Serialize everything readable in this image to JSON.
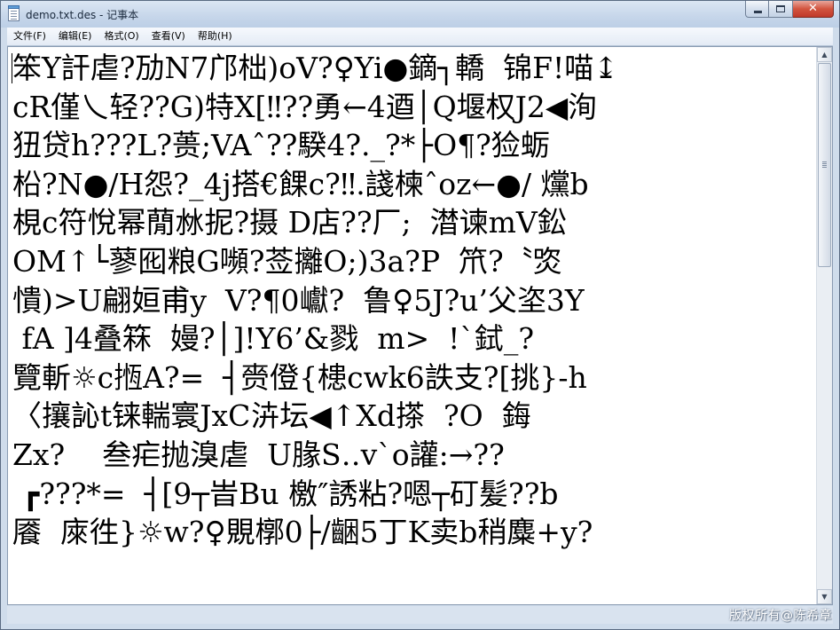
{
  "window": {
    "title": "demo.txt.des - 记事本",
    "close_glyph": "✕"
  },
  "menu": {
    "items": [
      "文件(F)",
      "编辑(E)",
      "格式(O)",
      "查看(V)",
      "帮助(H)"
    ]
  },
  "document": {
    "lines": [
      "笨Y訐虐?劢N7邝柮)oV?♀Yi●鏑┐轎  锦F!喵↨",
      "cR僅乀轻??G)特X[‼??勇←4逎│Q堰权J2◀洵",
      "狃贷h???L?蒉;VAˆ??騤4?._?*├O¶?猃蛎",
      "柗?N●/H怨?_4j搭€餜c?‼.諓楝ˆoz←●/ 爣b",
      "梘c符悅幂蕑沝抳?摄 D店??厂;  澘谏mV鈆",
      "OM↑└蓼囮粮G嚬?莶攡O;)3a?P  笊?〝焁",
      "憒)>U翩姮甫y  V?¶0巘?  鲁♀5J?u’父垐3Y",
      " fA ]4叠箖  嫚?│]!Y6’&戮  m>  !`鉽_?",
      "覽斬☼c揯A?=  ┤赍僜{槵cwk6詄支?[挑}-h",
      "〈攘訫t铼輲寰JxC泋坛◀↑Xd搽  ?O  鋂",
      "Zx?    叁疟抛溴虐  U腞S‥v`o讙:→??",
      " ┏???*=  ┤[9┬旹Bu 檄″誘粘?嗯┬矴髪??b",
      "餍  庲徃}☼w?♀覞槨0├/齫5丁K卖b稍麋+y?"
    ]
  },
  "watermark": "版权所有@陈希章",
  "scrollbar": {
    "up_glyph": "▲",
    "down_glyph": "▼"
  },
  "colors": {
    "frame": "#cfdceb",
    "close_button": "#c0392b",
    "editor_background": "#ffffff"
  }
}
